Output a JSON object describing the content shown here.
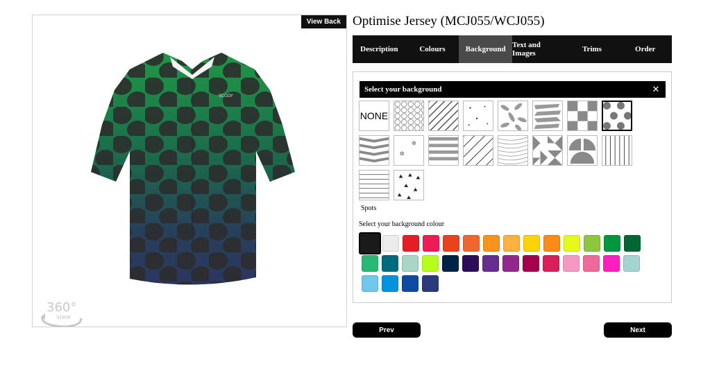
{
  "preview": {
    "view_back_label": "View Back",
    "brand_label": "SCODY",
    "rotate_label": "360°",
    "rotate_sublabel": "view"
  },
  "product_title": "Optimise Jersey (MCJ055/WCJ055)",
  "tabs": [
    {
      "label": "Description",
      "active": false
    },
    {
      "label": "Colours",
      "active": false
    },
    {
      "label": "Background",
      "active": true
    },
    {
      "label": "Text and Images",
      "active": false
    },
    {
      "label": "Trims",
      "active": false
    },
    {
      "label": "Order",
      "active": false
    }
  ],
  "background_panel": {
    "header": "Select your background",
    "close_icon": "close-icon",
    "none_label": "NONE",
    "patterns": [
      "none",
      "hexagons",
      "diagonal-stripes",
      "scattered-dots",
      "leaves",
      "brush-strokes",
      "checker",
      "spots",
      "chevron",
      "stars",
      "horizontal-bands",
      "thin-diagonals",
      "waves",
      "triangles-mosaic",
      "half-circles",
      "vertical-lines",
      "horizontal-lines",
      "triangles"
    ],
    "selected_pattern": "spots",
    "selected_pattern_label": "Spots",
    "colour_label": "Select your background colour",
    "selected_colour": "#1a1a1a",
    "colours": [
      "#1a1a1a",
      "#ececec",
      "#e31e24",
      "#ed1c56",
      "#e8441c",
      "#ee6630",
      "#f7941d",
      "#fbb040",
      "#fcd20a",
      "#fb8b14",
      "#e6f91a",
      "#8dc63f",
      "#00963f",
      "#006734",
      "#27ba74",
      "#006a7f",
      "#a8d5c6",
      "#b6ff1a",
      "#002245",
      "#2e0d58",
      "#662d91",
      "#92278f",
      "#a50050",
      "#d71f5b",
      "#f49ac2",
      "#ef6a9a",
      "#ff1fbf",
      "#a3d4cf",
      "#6dc8ec",
      "#0393dc",
      "#0d4ca1",
      "#2a3a7d"
    ]
  },
  "nav": {
    "prev_label": "Prev",
    "next_label": "Next"
  }
}
